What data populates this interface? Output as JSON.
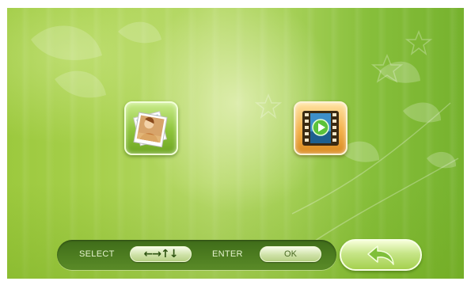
{
  "main": {
    "photos_icon": "photo-stack-icon",
    "video_icon": "film-play-icon"
  },
  "hint_bar": {
    "select_label": "SELECT",
    "arrows": "←→↑↓",
    "enter_label": "ENTER",
    "ok_label": "OK"
  },
  "back_button": {
    "icon": "back-arrow-icon"
  },
  "colors": {
    "background_green": "#a7d04c",
    "photos_tile": "#8ec43b",
    "video_tile": "#f3b04a",
    "hint_bar": "#4d7d20"
  }
}
